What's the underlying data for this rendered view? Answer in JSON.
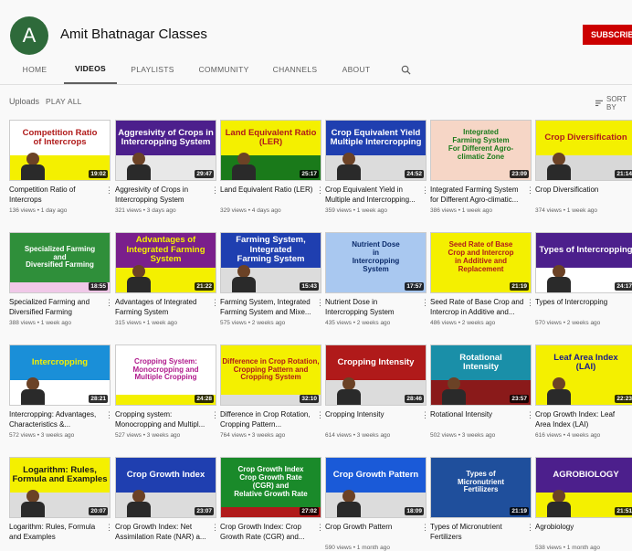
{
  "channel": {
    "name": "Amit Bhatnagar Classes",
    "avatar_letter": "A",
    "subscribe_label": "SUBSCRIBE"
  },
  "tabs": [
    {
      "label": "HOME",
      "active": false
    },
    {
      "label": "VIDEOS",
      "active": true
    },
    {
      "label": "PLAYLISTS",
      "active": false
    },
    {
      "label": "COMMUNITY",
      "active": false
    },
    {
      "label": "CHANNELS",
      "active": false
    },
    {
      "label": "ABOUT",
      "active": false
    }
  ],
  "section": {
    "title": "Uploads",
    "play_all": "PLAY ALL",
    "sort_label": "SORT BY"
  },
  "videos": [
    {
      "title": "Competition Ratio of Intercrops",
      "meta": "136 views • 1 day ago",
      "duration": "19:02",
      "thumb_lines": [
        "Competition Ratio",
        "of Intercrops"
      ],
      "thumb_bg": "#ffffff",
      "thumb_fg": "#b01a1a",
      "band": "#f4f000"
    },
    {
      "title": "Aggresivity of Crops in Intercropping System",
      "meta": "321 views • 3 days ago",
      "duration": "29:47",
      "thumb_lines": [
        "Aggresivity of Crops in",
        "Intercropping System"
      ],
      "thumb_bg": "#4c1f8c",
      "thumb_fg": "#ffffff",
      "band": "#e8e8e8"
    },
    {
      "title": "Land Equivalent Ratio (LER)",
      "meta": "329 views • 4 days ago",
      "duration": "25:17",
      "thumb_lines": [
        "Land Equivalent Ratio",
        "(LER)"
      ],
      "thumb_bg": "#f4f000",
      "thumb_fg": "#b01a1a",
      "band": "#1a7a1a"
    },
    {
      "title": "Crop Equivalent Yield in Multiple and Intercropping...",
      "meta": "359 views • 1 week ago",
      "duration": "24:52",
      "thumb_lines": [
        "Crop Equivalent Yield",
        "Multiple Intercropping"
      ],
      "thumb_bg": "#1f3fb0",
      "thumb_fg": "#ffffff",
      "band": "#dcdcdc"
    },
    {
      "title": "Integrated Farming System for Different Agro-climatic...",
      "meta": "386 views • 1 week ago",
      "duration": "23:09",
      "thumb_lines": [
        "Integrated",
        "Farming System",
        "For Different Agro-",
        "climatic Zone"
      ],
      "thumb_bg": "#f6d6c6",
      "thumb_fg": "#1a7a1a",
      "band": "#f6d6c6"
    },
    {
      "title": "Crop Diversification",
      "meta": "374 views • 1 week ago",
      "duration": "21:14",
      "thumb_lines": [
        "Crop Diversification"
      ],
      "thumb_bg": "#f4f000",
      "thumb_fg": "#b01a1a",
      "band": "#d8d8d8"
    },
    {
      "title": "Specialized Farming and Diversified Farming",
      "meta": "388 views • 1 week ago",
      "duration": "18:55",
      "thumb_lines": [
        "Specialized Farming",
        "and",
        "Diversified Farming"
      ],
      "thumb_bg": "#2f8f3a",
      "thumb_fg": "#ffffff",
      "band": "#f0c8e8"
    },
    {
      "title": "Advantages of Integrated Farming System",
      "meta": "315 views • 1 week ago",
      "duration": "21:22",
      "thumb_lines": [
        "Advantages of",
        "Integrated Farming System"
      ],
      "thumb_bg": "#7a1f8c",
      "thumb_fg": "#f4f000",
      "band": "#f4f000"
    },
    {
      "title": "Farming System, Integrated Farming System and Mixe...",
      "meta": "575 views • 2 weeks ago",
      "duration": "15:43",
      "thumb_lines": [
        "Farming System, Integrated",
        "Farming System"
      ],
      "thumb_bg": "#1f3fb0",
      "thumb_fg": "#ffffff",
      "band": "#dcdcdc"
    },
    {
      "title": "Nutrient Dose in Intercropping System",
      "meta": "435 views • 2 weeks ago",
      "duration": "17:57",
      "thumb_lines": [
        "Nutrient Dose",
        "in",
        "Intercropping",
        "System"
      ],
      "thumb_bg": "#a9c8f0",
      "thumb_fg": "#0a2a6a",
      "band": "#a9c8f0"
    },
    {
      "title": "Seed Rate of Base Crop and Intercrop in Additive and...",
      "meta": "486 views • 2 weeks ago",
      "duration": "21:19",
      "thumb_lines": [
        "Seed Rate of Base",
        "Crop and Intercrop",
        "in Additive and",
        "Replacement"
      ],
      "thumb_bg": "#f4f000",
      "thumb_fg": "#b01a1a",
      "band": "#f4f000"
    },
    {
      "title": "Types of Intercropping",
      "meta": "570 views • 2 weeks ago",
      "duration": "24:17",
      "thumb_lines": [
        "Types of Intercropping"
      ],
      "thumb_bg": "#4c1f8c",
      "thumb_fg": "#ffffff",
      "band": "#ffffff"
    },
    {
      "title": "Intercropping: Advantages, Characteristics &...",
      "meta": "572 views • 3 weeks ago",
      "duration": "28:21",
      "thumb_lines": [
        "Intercropping"
      ],
      "thumb_bg": "#1a8fd8",
      "thumb_fg": "#f4f000",
      "band": "#ffffff"
    },
    {
      "title": "Cropping system: Monocropping and Multipl...",
      "meta": "527 views • 3 weeks ago",
      "duration": "24:28",
      "thumb_lines": [
        "Cropping System:",
        "Monocropping and",
        "Multiple Cropping"
      ],
      "thumb_bg": "#ffffff",
      "thumb_fg": "#b01a8c",
      "band": "#f4f000"
    },
    {
      "title": "Difference in Crop Rotation, Cropping Pattern...",
      "meta": "764 views • 3 weeks ago",
      "duration": "32:10",
      "thumb_lines": [
        "Difference in Crop Rotation,",
        "Cropping Pattern and",
        "Cropping System"
      ],
      "thumb_bg": "#f4f000",
      "thumb_fg": "#b01a1a",
      "band": "#dcdcdc"
    },
    {
      "title": "Cropping Intensity",
      "meta": "614 views • 3 weeks ago",
      "duration": "28:46",
      "thumb_lines": [
        "Cropping Intensity"
      ],
      "thumb_bg": "#b01a1a",
      "thumb_fg": "#ffffff",
      "band": "#dcdcdc"
    },
    {
      "title": "Rotational Intensity",
      "meta": "502 views • 3 weeks ago",
      "duration": "23:57",
      "thumb_lines": [
        "Rotational",
        "Intensity"
      ],
      "thumb_bg": "#1a8fa8",
      "thumb_fg": "#ffffff",
      "band": "#8a1a1a"
    },
    {
      "title": "Crop Growth Index: Leaf Area Index (LAI)",
      "meta": "616 views • 4 weeks ago",
      "duration": "22:23",
      "thumb_lines": [
        "Leaf Area Index",
        "(LAI)"
      ],
      "thumb_bg": "#f4f000",
      "thumb_fg": "#1a1a8a",
      "band": "#f4f000"
    },
    {
      "title": "Logarithm: Rules, Formula and Examples",
      "meta": "",
      "duration": "20:07",
      "thumb_lines": [
        "Logarithm: Rules,",
        "Formula and Examples"
      ],
      "thumb_bg": "#f4f000",
      "thumb_fg": "#1a1a1a",
      "band": "#dcdcdc"
    },
    {
      "title": "Crop Growth Index: Net Assimilation Rate (NAR) a...",
      "meta": "",
      "duration": "23:07",
      "thumb_lines": [
        "Crop Growth Index"
      ],
      "thumb_bg": "#1f3fb0",
      "thumb_fg": "#ffffff",
      "band": "#dcdcdc"
    },
    {
      "title": "Crop Growth Index: Crop Growth Rate (CGR) and...",
      "meta": "",
      "duration": "27:02",
      "thumb_lines": [
        "Crop Growth Index",
        "Crop Growth Rate",
        "(CGR) and",
        "Relative Growth Rate"
      ],
      "thumb_bg": "#1a8a2a",
      "thumb_fg": "#ffffff",
      "band": "#b01a1a"
    },
    {
      "title": "Crop Growth Pattern",
      "meta": "590 views • 1 month ago",
      "duration": "18:09",
      "thumb_lines": [
        "Crop Growth Pattern"
      ],
      "thumb_bg": "#1a5ad8",
      "thumb_fg": "#ffffff",
      "band": "#dcdcdc"
    },
    {
      "title": "Types of Micronutrient Fertilizers",
      "meta": "",
      "duration": "21:19",
      "thumb_lines": [
        "Types of",
        "Micronutrient",
        "Fertilizers"
      ],
      "thumb_bg": "#1f4f9c",
      "thumb_fg": "#ffffff",
      "band": "#1f4f9c"
    },
    {
      "title": "Agrobiology",
      "meta": "538 views • 1 month ago",
      "duration": "21:51",
      "thumb_lines": [
        "AGROBIOLOGY"
      ],
      "thumb_bg": "#4c1f8c",
      "thumb_fg": "#ffffff",
      "band": "#f4f000"
    }
  ]
}
